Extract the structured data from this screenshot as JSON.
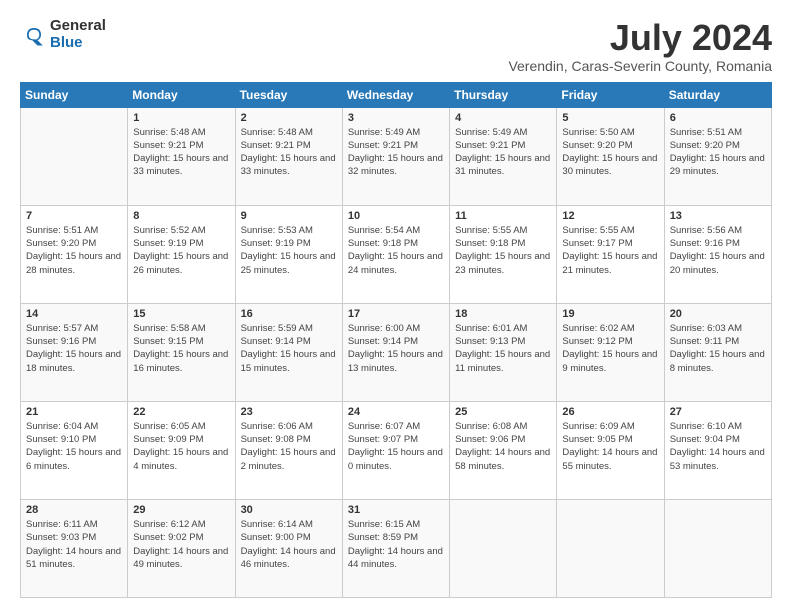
{
  "logo": {
    "general": "General",
    "blue": "Blue"
  },
  "title": "July 2024",
  "subtitle": "Verendin, Caras-Severin County, Romania",
  "headers": [
    "Sunday",
    "Monday",
    "Tuesday",
    "Wednesday",
    "Thursday",
    "Friday",
    "Saturday"
  ],
  "weeks": [
    [
      {
        "day": "",
        "sunrise": "",
        "sunset": "",
        "daylight": ""
      },
      {
        "day": "1",
        "sunrise": "Sunrise: 5:48 AM",
        "sunset": "Sunset: 9:21 PM",
        "daylight": "Daylight: 15 hours and 33 minutes."
      },
      {
        "day": "2",
        "sunrise": "Sunrise: 5:48 AM",
        "sunset": "Sunset: 9:21 PM",
        "daylight": "Daylight: 15 hours and 33 minutes."
      },
      {
        "day": "3",
        "sunrise": "Sunrise: 5:49 AM",
        "sunset": "Sunset: 9:21 PM",
        "daylight": "Daylight: 15 hours and 32 minutes."
      },
      {
        "day": "4",
        "sunrise": "Sunrise: 5:49 AM",
        "sunset": "Sunset: 9:21 PM",
        "daylight": "Daylight: 15 hours and 31 minutes."
      },
      {
        "day": "5",
        "sunrise": "Sunrise: 5:50 AM",
        "sunset": "Sunset: 9:20 PM",
        "daylight": "Daylight: 15 hours and 30 minutes."
      },
      {
        "day": "6",
        "sunrise": "Sunrise: 5:51 AM",
        "sunset": "Sunset: 9:20 PM",
        "daylight": "Daylight: 15 hours and 29 minutes."
      }
    ],
    [
      {
        "day": "7",
        "sunrise": "Sunrise: 5:51 AM",
        "sunset": "Sunset: 9:20 PM",
        "daylight": "Daylight: 15 hours and 28 minutes."
      },
      {
        "day": "8",
        "sunrise": "Sunrise: 5:52 AM",
        "sunset": "Sunset: 9:19 PM",
        "daylight": "Daylight: 15 hours and 26 minutes."
      },
      {
        "day": "9",
        "sunrise": "Sunrise: 5:53 AM",
        "sunset": "Sunset: 9:19 PM",
        "daylight": "Daylight: 15 hours and 25 minutes."
      },
      {
        "day": "10",
        "sunrise": "Sunrise: 5:54 AM",
        "sunset": "Sunset: 9:18 PM",
        "daylight": "Daylight: 15 hours and 24 minutes."
      },
      {
        "day": "11",
        "sunrise": "Sunrise: 5:55 AM",
        "sunset": "Sunset: 9:18 PM",
        "daylight": "Daylight: 15 hours and 23 minutes."
      },
      {
        "day": "12",
        "sunrise": "Sunrise: 5:55 AM",
        "sunset": "Sunset: 9:17 PM",
        "daylight": "Daylight: 15 hours and 21 minutes."
      },
      {
        "day": "13",
        "sunrise": "Sunrise: 5:56 AM",
        "sunset": "Sunset: 9:16 PM",
        "daylight": "Daylight: 15 hours and 20 minutes."
      }
    ],
    [
      {
        "day": "14",
        "sunrise": "Sunrise: 5:57 AM",
        "sunset": "Sunset: 9:16 PM",
        "daylight": "Daylight: 15 hours and 18 minutes."
      },
      {
        "day": "15",
        "sunrise": "Sunrise: 5:58 AM",
        "sunset": "Sunset: 9:15 PM",
        "daylight": "Daylight: 15 hours and 16 minutes."
      },
      {
        "day": "16",
        "sunrise": "Sunrise: 5:59 AM",
        "sunset": "Sunset: 9:14 PM",
        "daylight": "Daylight: 15 hours and 15 minutes."
      },
      {
        "day": "17",
        "sunrise": "Sunrise: 6:00 AM",
        "sunset": "Sunset: 9:14 PM",
        "daylight": "Daylight: 15 hours and 13 minutes."
      },
      {
        "day": "18",
        "sunrise": "Sunrise: 6:01 AM",
        "sunset": "Sunset: 9:13 PM",
        "daylight": "Daylight: 15 hours and 11 minutes."
      },
      {
        "day": "19",
        "sunrise": "Sunrise: 6:02 AM",
        "sunset": "Sunset: 9:12 PM",
        "daylight": "Daylight: 15 hours and 9 minutes."
      },
      {
        "day": "20",
        "sunrise": "Sunrise: 6:03 AM",
        "sunset": "Sunset: 9:11 PM",
        "daylight": "Daylight: 15 hours and 8 minutes."
      }
    ],
    [
      {
        "day": "21",
        "sunrise": "Sunrise: 6:04 AM",
        "sunset": "Sunset: 9:10 PM",
        "daylight": "Daylight: 15 hours and 6 minutes."
      },
      {
        "day": "22",
        "sunrise": "Sunrise: 6:05 AM",
        "sunset": "Sunset: 9:09 PM",
        "daylight": "Daylight: 15 hours and 4 minutes."
      },
      {
        "day": "23",
        "sunrise": "Sunrise: 6:06 AM",
        "sunset": "Sunset: 9:08 PM",
        "daylight": "Daylight: 15 hours and 2 minutes."
      },
      {
        "day": "24",
        "sunrise": "Sunrise: 6:07 AM",
        "sunset": "Sunset: 9:07 PM",
        "daylight": "Daylight: 15 hours and 0 minutes."
      },
      {
        "day": "25",
        "sunrise": "Sunrise: 6:08 AM",
        "sunset": "Sunset: 9:06 PM",
        "daylight": "Daylight: 14 hours and 58 minutes."
      },
      {
        "day": "26",
        "sunrise": "Sunrise: 6:09 AM",
        "sunset": "Sunset: 9:05 PM",
        "daylight": "Daylight: 14 hours and 55 minutes."
      },
      {
        "day": "27",
        "sunrise": "Sunrise: 6:10 AM",
        "sunset": "Sunset: 9:04 PM",
        "daylight": "Daylight: 14 hours and 53 minutes."
      }
    ],
    [
      {
        "day": "28",
        "sunrise": "Sunrise: 6:11 AM",
        "sunset": "Sunset: 9:03 PM",
        "daylight": "Daylight: 14 hours and 51 minutes."
      },
      {
        "day": "29",
        "sunrise": "Sunrise: 6:12 AM",
        "sunset": "Sunset: 9:02 PM",
        "daylight": "Daylight: 14 hours and 49 minutes."
      },
      {
        "day": "30",
        "sunrise": "Sunrise: 6:14 AM",
        "sunset": "Sunset: 9:00 PM",
        "daylight": "Daylight: 14 hours and 46 minutes."
      },
      {
        "day": "31",
        "sunrise": "Sunrise: 6:15 AM",
        "sunset": "Sunset: 8:59 PM",
        "daylight": "Daylight: 14 hours and 44 minutes."
      },
      {
        "day": "",
        "sunrise": "",
        "sunset": "",
        "daylight": ""
      },
      {
        "day": "",
        "sunrise": "",
        "sunset": "",
        "daylight": ""
      },
      {
        "day": "",
        "sunrise": "",
        "sunset": "",
        "daylight": ""
      }
    ]
  ]
}
